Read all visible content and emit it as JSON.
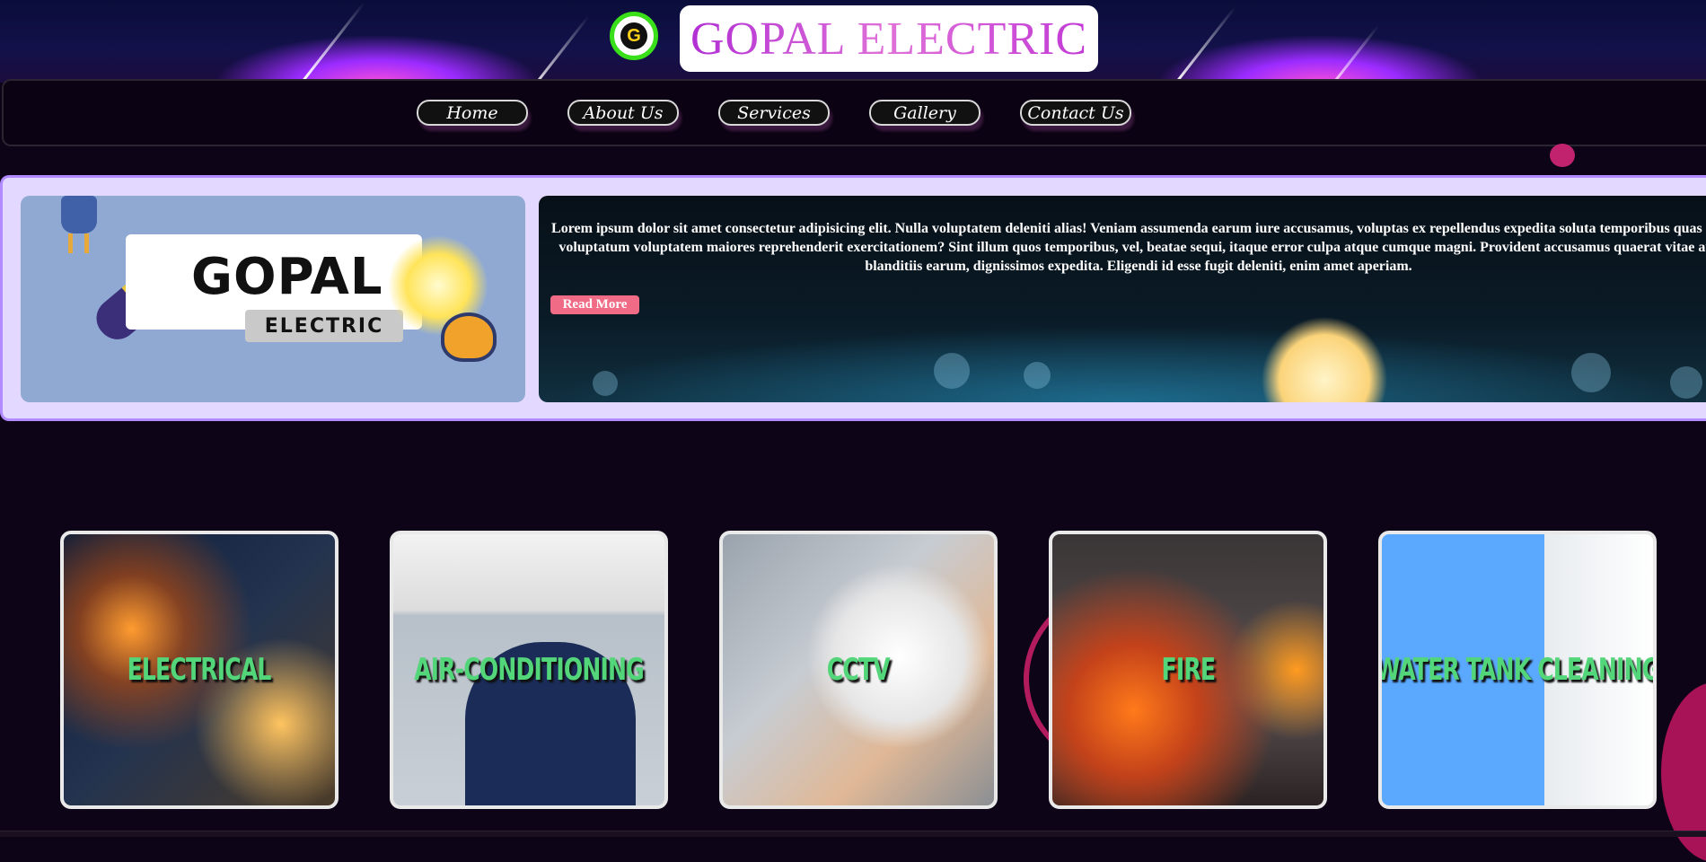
{
  "header": {
    "logo_icon": "g-logo-icon",
    "brand_title": "GOPAL ELECTRIC"
  },
  "nav": {
    "items": [
      {
        "label": "Home"
      },
      {
        "label": "About Us"
      },
      {
        "label": "Services"
      },
      {
        "label": "Gallery"
      },
      {
        "label": "Contact Us"
      }
    ]
  },
  "hero": {
    "image_title": "GOPAL",
    "image_subtitle": "ELECTRIC",
    "paragraph": "Lorem ipsum dolor sit amet consectetur adipisicing elit. Nulla voluptatem deleniti alias! Veniam assumenda earum iure accusamus, voluptas ex repellendus expedita soluta temporibus quas qui voluptatum voluptatem maiores reprehenderit exercitationem? Sint illum quos temporibus, vel, beatae sequi, itaque error culpa atque cumque magni. Provident accusamus quaerat vitae aut blanditiis earum, dignissimos expedita. Eligendi id esse fugit deleniti, enim amet aperiam.",
    "read_more_label": "Read More"
  },
  "services": [
    {
      "label": "ELECTRICAL"
    },
    {
      "label": "AIR-CONDITIONING"
    },
    {
      "label": "CCTV"
    },
    {
      "label": "FIRE"
    },
    {
      "label": "WATER TANK CLEANING"
    }
  ],
  "colors": {
    "service_label": "#53d67a",
    "read_more_bg": "#f06b86",
    "hero_frame": "#e3d8ff",
    "logo_ring": "#39e01a"
  }
}
